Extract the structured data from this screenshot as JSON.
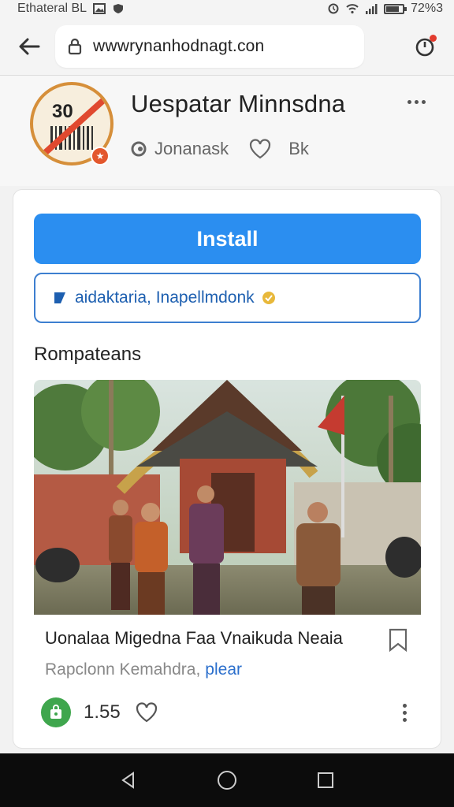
{
  "status_bar": {
    "left_text": "Ethateral BL",
    "right_text": "72%3",
    "battery_level": 0.8,
    "icons": [
      "image-icon",
      "shield-icon",
      "alarm-icon",
      "wifi-icon",
      "signal-icon",
      "battery-icon"
    ]
  },
  "browser": {
    "url": "wwwrynanhodnagt.con",
    "back_icon": "arrow-left-icon",
    "lock_icon": "lock-icon",
    "extension_icon": "extension-icon",
    "notification_color": "#e23b2e"
  },
  "app": {
    "logo_code": "30",
    "title": "Uespatar Minnsdna",
    "author": "Jonanask",
    "likes": "Bk",
    "badge_text": "★"
  },
  "actions": {
    "install_label": "Install",
    "tag_text": "aidaktaria, Inapellmdonk",
    "accent": "#2b8ef0"
  },
  "section": {
    "title": "Rompateans"
  },
  "post": {
    "title": "Uonalaa Migedna Faa Vnaikuda Neaia",
    "subtitle": "Rapclonn Kemahdra,",
    "subtitle_link": "plear",
    "count": "1.55",
    "image_alt": "Group of men in batik standing in front of a traditional gate building"
  },
  "nav": {
    "back": "nav-back-icon",
    "home": "nav-home-icon",
    "recents": "nav-recents-icon"
  }
}
